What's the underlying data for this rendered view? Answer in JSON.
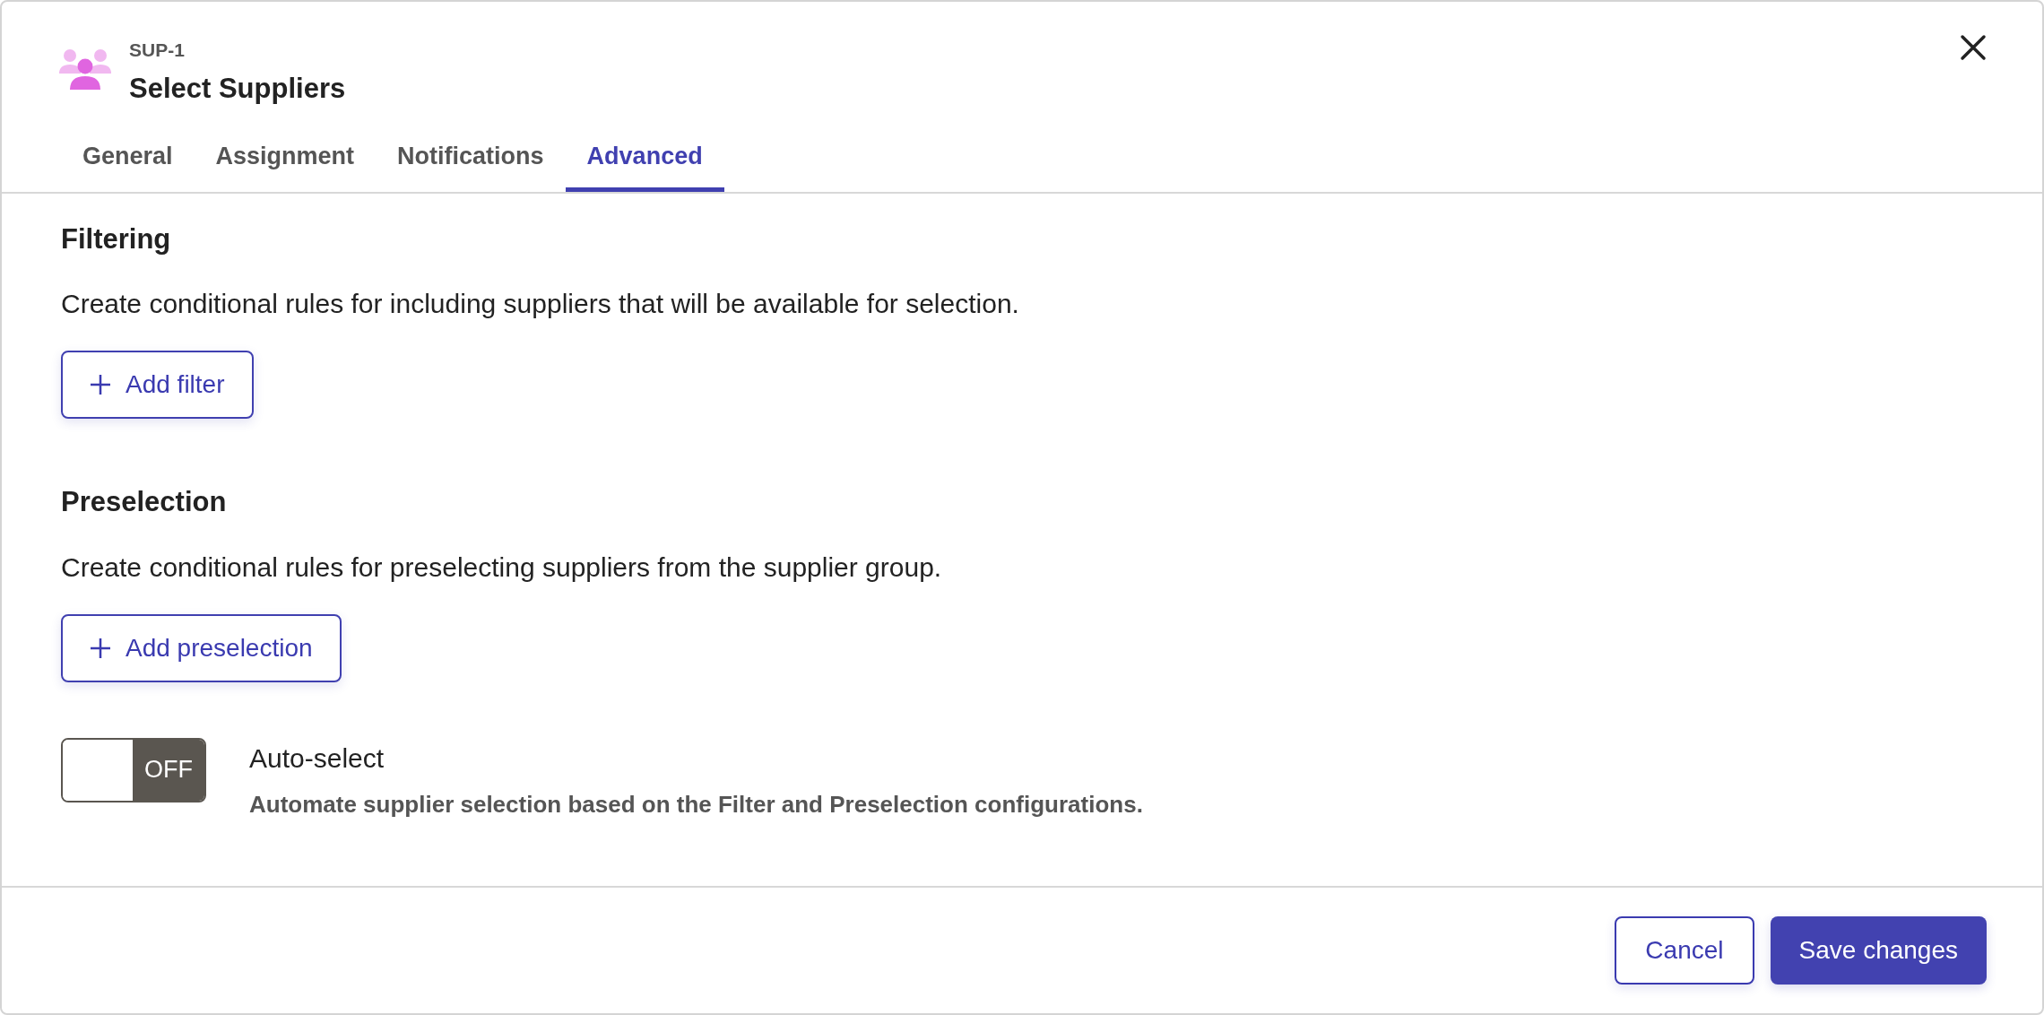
{
  "header": {
    "code": "SUP-1",
    "title": "Select Suppliers"
  },
  "tabs": [
    {
      "label": "General",
      "selected": false
    },
    {
      "label": "Assignment",
      "selected": false
    },
    {
      "label": "Notifications",
      "selected": false
    },
    {
      "label": "Advanced",
      "selected": true
    }
  ],
  "sections": [
    {
      "heading": "Filtering",
      "description": "Create conditional rules for including suppliers that will be available for selection.",
      "button": "Add filter"
    },
    {
      "heading": "Preselection",
      "description": "Create conditional rules for preselecting suppliers from the supplier group.",
      "button": "Add preselection"
    }
  ],
  "auto_select": {
    "on": false,
    "toggle_text": "OFF",
    "label": "Auto-select",
    "description": "Automate supplier selection based on the Filter and Preselection configurations."
  },
  "footer": {
    "buttons": [
      {
        "label": "Cancel",
        "kind": "secondary"
      },
      {
        "label": "Save changes",
        "kind": "primary"
      }
    ]
  }
}
